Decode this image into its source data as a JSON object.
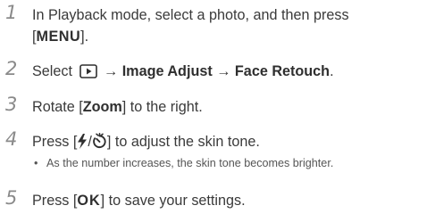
{
  "steps": [
    {
      "number": "1",
      "line1": "In Playback mode, select a photo, and then press",
      "open": "[",
      "key": "MENU",
      "close": "]."
    },
    {
      "number": "2",
      "pre": "Select",
      "icon": "playback-icon",
      "arrow1": "→",
      "item1": "Image Adjust",
      "arrow2": "→",
      "item2": "Face Retouch",
      "end": "."
    },
    {
      "number": "3",
      "pre": "Rotate [",
      "key": "Zoom",
      "post": "] to the right."
    },
    {
      "number": "4",
      "pre": "Press [",
      "slash": "/",
      "post": "] to adjust the skin tone.",
      "icon1": "flash-icon",
      "icon2": "self-timer-icon",
      "bullet": "•",
      "note": "As the number increases, the skin tone becomes brighter."
    },
    {
      "number": "5",
      "pre": "Press [",
      "key": "OK",
      "post": "] to save your settings."
    }
  ]
}
